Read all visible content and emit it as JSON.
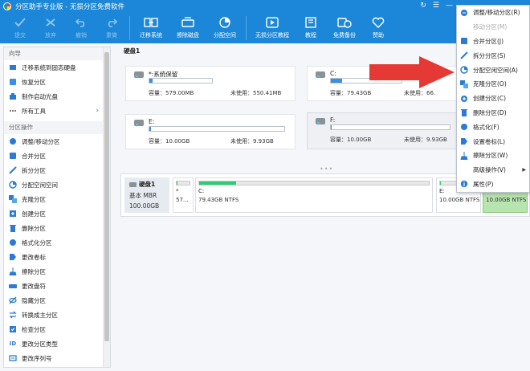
{
  "window": {
    "title": "分区助手专业版 - 无损分区免费软件",
    "controls": [
      "↻",
      "☰",
      "—"
    ]
  },
  "toolbar": {
    "buttons": [
      {
        "label": "提交",
        "icon": "check-icon",
        "disabled": true
      },
      {
        "label": "放弃",
        "icon": "discard-icon",
        "disabled": true
      },
      {
        "label": "撤销",
        "icon": "undo-icon",
        "disabled": true
      },
      {
        "label": "重做",
        "icon": "redo-icon",
        "disabled": true
      },
      {
        "label": "迁移系统",
        "icon": "migrate-os-icon",
        "disabled": false
      },
      {
        "label": "擦除磁盘",
        "icon": "wipe-disk-icon",
        "disabled": false
      },
      {
        "label": "分配空间",
        "icon": "allocate-space-icon",
        "disabled": false
      },
      {
        "label": "无损分区教程",
        "icon": "tutorial-play-icon",
        "disabled": false
      },
      {
        "label": "教程",
        "icon": "book-icon",
        "disabled": false
      },
      {
        "label": "免费备份",
        "icon": "backup-icon",
        "disabled": false
      },
      {
        "label": "赞助",
        "icon": "heart-icon",
        "disabled": false
      }
    ]
  },
  "sidebar": {
    "wizard_title": "向导",
    "wizard_items": [
      {
        "label": "迁移系统到固态硬盘",
        "icon": "migrate-ssd-icon"
      },
      {
        "label": "恢复分区",
        "icon": "recover-partition-icon"
      },
      {
        "label": "制作启动光盘",
        "icon": "boot-disc-icon"
      },
      {
        "label": "所有工具",
        "icon": "more-tools-icon",
        "more": "›"
      }
    ],
    "ops_title": "分区操作",
    "ops_items": [
      {
        "label": "调整/移动分区",
        "icon": "resize-icon"
      },
      {
        "label": "合并分区",
        "icon": "merge-icon"
      },
      {
        "label": "拆分分区",
        "icon": "split-icon"
      },
      {
        "label": "分配空闲空间",
        "icon": "allocate-free-icon"
      },
      {
        "label": "克隆分区",
        "icon": "clone-icon"
      },
      {
        "label": "创建分区",
        "icon": "create-icon"
      },
      {
        "label": "删除分区",
        "icon": "delete-icon"
      },
      {
        "label": "格式化分区",
        "icon": "format-icon"
      },
      {
        "label": "更改卷标",
        "icon": "label-icon"
      },
      {
        "label": "擦除分区",
        "icon": "wipe-icon"
      },
      {
        "label": "更改盘符",
        "icon": "drive-letter-icon"
      },
      {
        "label": "隐藏分区",
        "icon": "hide-icon"
      },
      {
        "label": "转换成主分区",
        "icon": "convert-icon"
      },
      {
        "label": "检查分区",
        "icon": "check-partition-icon"
      },
      {
        "label": "更改分区类型",
        "icon": "id-icon"
      },
      {
        "label": "更改序列号",
        "icon": "serial-icon"
      }
    ]
  },
  "main": {
    "disk_title": "硬盘1",
    "partitions": [
      {
        "name": "*:系统保留",
        "capacity_label": "容量：",
        "capacity": "579.00MB",
        "free_label": "未使用：",
        "free": "550.41MB",
        "fill": 0.05
      },
      {
        "name": "C:",
        "capacity_label": "容量：",
        "capacity": "79.43GB",
        "free_label": "未使用：",
        "free": "66.",
        "fill": 0.16
      },
      {
        "name": "E:",
        "capacity_label": "容量：",
        "capacity": "10.00GB",
        "free_label": "未使用：",
        "free": "9.93GB",
        "fill": 0.01
      },
      {
        "name": "F:",
        "capacity_label": "容量：",
        "capacity": "10.00GB",
        "free_label": "未使用：",
        "free": "9.93GB",
        "fill": 0.01
      }
    ],
    "drag_dots": "•••"
  },
  "disk_map": {
    "label": "硬盘1",
    "type": "基本 MBR",
    "size": "100.00GB",
    "segments": [
      {
        "label": "*",
        "size": "57..."
      },
      {
        "label": "C:",
        "size": "79.43GB NTFS"
      },
      {
        "label": "E:",
        "size": "10.00GB NTFS"
      },
      {
        "label": "F:",
        "size": "10.00GB NTFS"
      }
    ]
  },
  "context_menu": {
    "items": [
      {
        "label": "调整/移动分区(R)",
        "icon": "resize-icon",
        "disabled": false
      },
      {
        "label": "移动分区(M)",
        "icon": "move-icon",
        "disabled": true
      },
      {
        "label": "合并分区(J)",
        "icon": "merge-icon",
        "disabled": false
      },
      {
        "label": "拆分分区(S)",
        "icon": "split-icon",
        "disabled": false
      },
      {
        "label": "分配空闲空间(A)",
        "icon": "allocate-free-icon",
        "disabled": false
      },
      {
        "label": "克隆分区(O)",
        "icon": "clone-icon",
        "disabled": false
      },
      {
        "label": "创建分区(C)",
        "icon": "create-icon",
        "disabled": false
      },
      {
        "label": "删除分区(D)",
        "icon": "delete-icon",
        "disabled": false
      },
      {
        "label": "格式化(F)",
        "icon": "format-icon",
        "disabled": false
      },
      {
        "label": "设置卷标(L)",
        "icon": "label-icon",
        "disabled": false
      },
      {
        "label": "擦除分区(W)",
        "icon": "wipe-icon",
        "disabled": false
      },
      {
        "label": "高级操作(V)",
        "icon": "advanced-icon",
        "disabled": false,
        "submenu": "▶"
      },
      {
        "label": "属性(P)",
        "icon": "info-icon",
        "disabled": false
      }
    ]
  },
  "colors": {
    "accent": "#1c87d8",
    "selected_partition": "#b8e4b0",
    "arrow": "#e53935"
  }
}
